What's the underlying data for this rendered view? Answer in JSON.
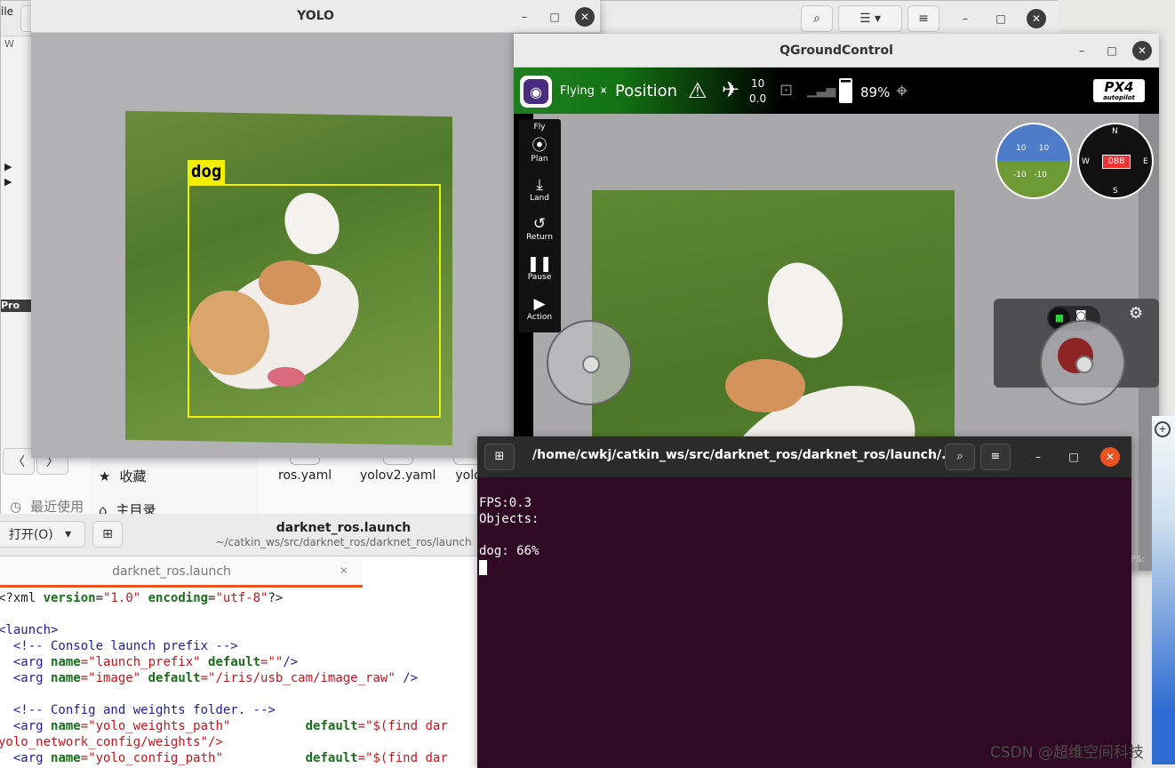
{
  "files_window": {
    "nav_back": "〈",
    "nav_forward": "〉",
    "sidebar": {
      "starred": "收藏",
      "home": "主目录",
      "recent": "最近使用"
    },
    "files": [
      "ros.yaml",
      "yolov2.yaml",
      "yolo"
    ],
    "left_edge_labels": [
      "ile",
      "W",
      "Pro"
    ]
  },
  "yolo_window": {
    "title": "YOLO",
    "detection_label": "dog"
  },
  "qgc_window": {
    "title": "QGroundControl",
    "flight_state": "Flying",
    "flight_mode": "Position",
    "satellites": "10",
    "hdop": "0.0",
    "battery": "89%",
    "brand": "PX4",
    "brand_sub": "autopilot",
    "tools": [
      "Fly",
      "Plan",
      "Land",
      "Return",
      "Pause",
      "Action"
    ],
    "attitude_upper": [
      "10",
      "10"
    ],
    "attitude_lower": [
      "-10",
      "-10"
    ],
    "heading": "088",
    "compass": {
      "n": "N",
      "e": "E",
      "s": "S",
      "w": "W"
    },
    "status_partial": "PS:"
  },
  "terminal": {
    "title": "/home/cwkj/catkin_ws/src/darknet_ros/darknet_ros/launch/...",
    "fps_line": "FPS:0.3",
    "objects_line": "Objects:",
    "detection_line": "dog: 66%"
  },
  "gedit": {
    "open_label": "打开(O)",
    "title": "darknet_ros.launch",
    "subtitle": "~/catkin_ws/src/darknet_ros/darknet_ros/launch",
    "tab": "darknet_ros.launch",
    "code": {
      "l1_a": "<?xml ",
      "l1_k1": "version",
      "l1_eq1": "=",
      "l1_s1": "\"1.0\"",
      "l1_k2": " encoding",
      "l1_eq2": "=",
      "l1_s2": "\"utf-8\"",
      "l1_end": "?>",
      "l3": "<launch>",
      "l4": "  <!-- Console launch prefix -->",
      "l5_a": "  <arg ",
      "l5_k1": "name",
      "l5_s1": "=\"launch_prefix\"",
      "l5_k2": " default",
      "l5_s2": "=\"\"",
      "l5_end": "/>",
      "l6_a": "  <arg ",
      "l6_k1": "name",
      "l6_s1": "=\"image\"",
      "l6_k2": " default",
      "l6_s2": "=\"/iris/usb_cam/image_raw\"",
      "l6_end": " />",
      "l8": "  <!-- Config and weights folder. -->",
      "l9_a": "  <arg ",
      "l9_k1": "name",
      "l9_s1": "=\"yolo_weights_path\"",
      "l9_k2": "          default",
      "l9_s2": "=\"$(find dar",
      "l10": "yolo_network_config/weights\"/>",
      "l11_a": "  <arg ",
      "l11_k1": "name",
      "l11_s1": "=\"yolo_config_path\"",
      "l11_k2": "           default",
      "l11_s2": "=\"$(find dar"
    }
  },
  "watermark": "CSDN @超维空间科技"
}
